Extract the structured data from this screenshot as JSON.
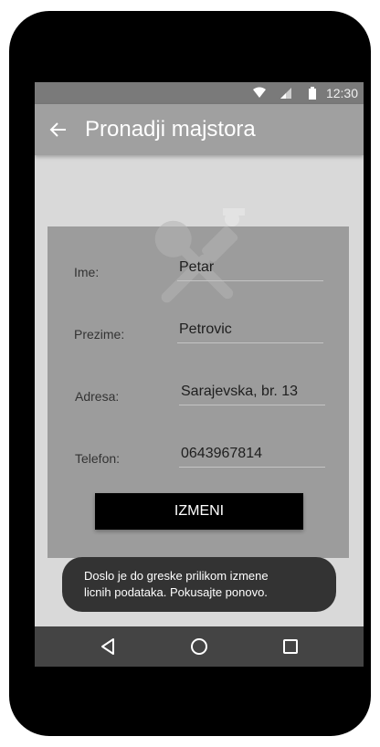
{
  "status_bar": {
    "time": "12:30",
    "icons": [
      "wifi-icon",
      "signal-icon",
      "battery-icon"
    ]
  },
  "app_bar": {
    "title": "Pronadji majstora",
    "back_icon": "arrow-left-icon"
  },
  "logo": {
    "icon": "wrench-screwdriver-icon"
  },
  "form": {
    "ime": {
      "label": "Ime:",
      "value": "Petar"
    },
    "prezime": {
      "label": "Prezime:",
      "value": "Petrovic"
    },
    "adresa": {
      "label": "Adresa:",
      "value": "Sarajevska, br. 13"
    },
    "telefon": {
      "label": "Telefon:",
      "value": "0643967814"
    },
    "submit_label": "IZMENI"
  },
  "toast": {
    "line1": "Doslo je do greske prilikom izmene",
    "line2": "licnih podataka. Pokusajte ponovo."
  },
  "nav_bar": {
    "icons": [
      "nav-back-icon",
      "nav-home-icon",
      "nav-recent-icon"
    ]
  },
  "colors": {
    "status_bar": "#7a7a7a",
    "app_bar": "#a0a0a0",
    "background": "#d9d9d9",
    "card": "#9c9c9c",
    "button": "#000000",
    "toast": "#333333",
    "nav_bar": "#444444"
  }
}
